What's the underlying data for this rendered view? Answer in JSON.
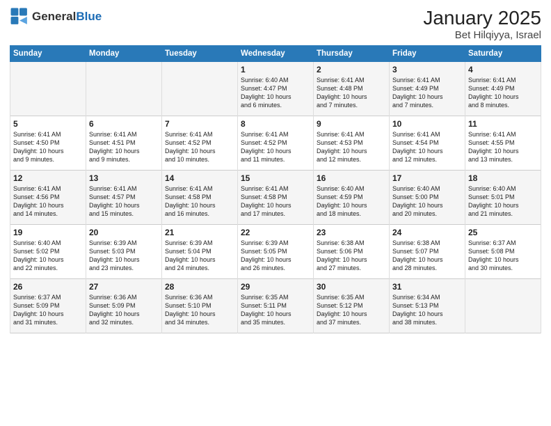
{
  "header": {
    "logo_general": "General",
    "logo_blue": "Blue",
    "title": "January 2025",
    "subtitle": "Bet Hilqiyya, Israel"
  },
  "days_of_week": [
    "Sunday",
    "Monday",
    "Tuesday",
    "Wednesday",
    "Thursday",
    "Friday",
    "Saturday"
  ],
  "weeks": [
    [
      {
        "day": "",
        "text": ""
      },
      {
        "day": "",
        "text": ""
      },
      {
        "day": "",
        "text": ""
      },
      {
        "day": "1",
        "text": "Sunrise: 6:40 AM\nSunset: 4:47 PM\nDaylight: 10 hours\nand 6 minutes."
      },
      {
        "day": "2",
        "text": "Sunrise: 6:41 AM\nSunset: 4:48 PM\nDaylight: 10 hours\nand 7 minutes."
      },
      {
        "day": "3",
        "text": "Sunrise: 6:41 AM\nSunset: 4:49 PM\nDaylight: 10 hours\nand 7 minutes."
      },
      {
        "day": "4",
        "text": "Sunrise: 6:41 AM\nSunset: 4:49 PM\nDaylight: 10 hours\nand 8 minutes."
      }
    ],
    [
      {
        "day": "5",
        "text": "Sunrise: 6:41 AM\nSunset: 4:50 PM\nDaylight: 10 hours\nand 9 minutes."
      },
      {
        "day": "6",
        "text": "Sunrise: 6:41 AM\nSunset: 4:51 PM\nDaylight: 10 hours\nand 9 minutes."
      },
      {
        "day": "7",
        "text": "Sunrise: 6:41 AM\nSunset: 4:52 PM\nDaylight: 10 hours\nand 10 minutes."
      },
      {
        "day": "8",
        "text": "Sunrise: 6:41 AM\nSunset: 4:52 PM\nDaylight: 10 hours\nand 11 minutes."
      },
      {
        "day": "9",
        "text": "Sunrise: 6:41 AM\nSunset: 4:53 PM\nDaylight: 10 hours\nand 12 minutes."
      },
      {
        "day": "10",
        "text": "Sunrise: 6:41 AM\nSunset: 4:54 PM\nDaylight: 10 hours\nand 12 minutes."
      },
      {
        "day": "11",
        "text": "Sunrise: 6:41 AM\nSunset: 4:55 PM\nDaylight: 10 hours\nand 13 minutes."
      }
    ],
    [
      {
        "day": "12",
        "text": "Sunrise: 6:41 AM\nSunset: 4:56 PM\nDaylight: 10 hours\nand 14 minutes."
      },
      {
        "day": "13",
        "text": "Sunrise: 6:41 AM\nSunset: 4:57 PM\nDaylight: 10 hours\nand 15 minutes."
      },
      {
        "day": "14",
        "text": "Sunrise: 6:41 AM\nSunset: 4:58 PM\nDaylight: 10 hours\nand 16 minutes."
      },
      {
        "day": "15",
        "text": "Sunrise: 6:41 AM\nSunset: 4:58 PM\nDaylight: 10 hours\nand 17 minutes."
      },
      {
        "day": "16",
        "text": "Sunrise: 6:40 AM\nSunset: 4:59 PM\nDaylight: 10 hours\nand 18 minutes."
      },
      {
        "day": "17",
        "text": "Sunrise: 6:40 AM\nSunset: 5:00 PM\nDaylight: 10 hours\nand 20 minutes."
      },
      {
        "day": "18",
        "text": "Sunrise: 6:40 AM\nSunset: 5:01 PM\nDaylight: 10 hours\nand 21 minutes."
      }
    ],
    [
      {
        "day": "19",
        "text": "Sunrise: 6:40 AM\nSunset: 5:02 PM\nDaylight: 10 hours\nand 22 minutes."
      },
      {
        "day": "20",
        "text": "Sunrise: 6:39 AM\nSunset: 5:03 PM\nDaylight: 10 hours\nand 23 minutes."
      },
      {
        "day": "21",
        "text": "Sunrise: 6:39 AM\nSunset: 5:04 PM\nDaylight: 10 hours\nand 24 minutes."
      },
      {
        "day": "22",
        "text": "Sunrise: 6:39 AM\nSunset: 5:05 PM\nDaylight: 10 hours\nand 26 minutes."
      },
      {
        "day": "23",
        "text": "Sunrise: 6:38 AM\nSunset: 5:06 PM\nDaylight: 10 hours\nand 27 minutes."
      },
      {
        "day": "24",
        "text": "Sunrise: 6:38 AM\nSunset: 5:07 PM\nDaylight: 10 hours\nand 28 minutes."
      },
      {
        "day": "25",
        "text": "Sunrise: 6:37 AM\nSunset: 5:08 PM\nDaylight: 10 hours\nand 30 minutes."
      }
    ],
    [
      {
        "day": "26",
        "text": "Sunrise: 6:37 AM\nSunset: 5:09 PM\nDaylight: 10 hours\nand 31 minutes."
      },
      {
        "day": "27",
        "text": "Sunrise: 6:36 AM\nSunset: 5:09 PM\nDaylight: 10 hours\nand 32 minutes."
      },
      {
        "day": "28",
        "text": "Sunrise: 6:36 AM\nSunset: 5:10 PM\nDaylight: 10 hours\nand 34 minutes."
      },
      {
        "day": "29",
        "text": "Sunrise: 6:35 AM\nSunset: 5:11 PM\nDaylight: 10 hours\nand 35 minutes."
      },
      {
        "day": "30",
        "text": "Sunrise: 6:35 AM\nSunset: 5:12 PM\nDaylight: 10 hours\nand 37 minutes."
      },
      {
        "day": "31",
        "text": "Sunrise: 6:34 AM\nSunset: 5:13 PM\nDaylight: 10 hours\nand 38 minutes."
      },
      {
        "day": "",
        "text": ""
      }
    ]
  ]
}
